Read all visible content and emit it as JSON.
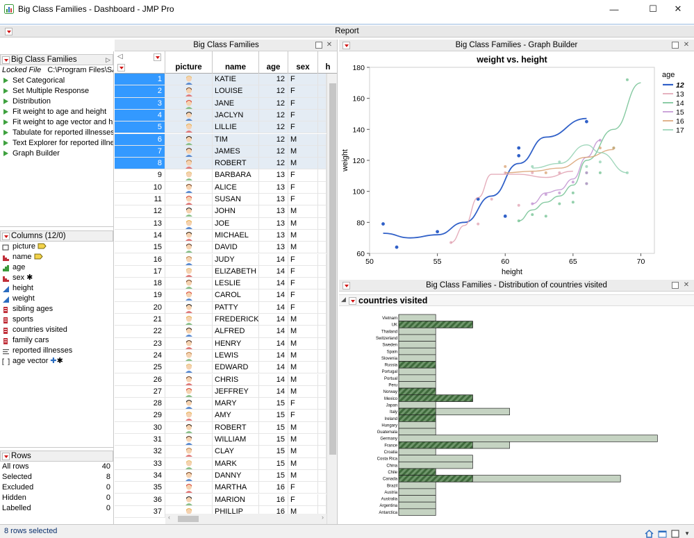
{
  "window": {
    "title": "Big Class Families - Dashboard - JMP Pro",
    "minimize_glyph": "—",
    "maximize_glyph": "☐",
    "close_glyph": "✕"
  },
  "report": {
    "title": "Report"
  },
  "table_panel": {
    "title": "Big Class Families"
  },
  "left": {
    "table_box": {
      "title": "Big Class Families",
      "locked_label": "Locked File",
      "locked_path": "C:\\Program Files\\SAS",
      "scripts": [
        "Set Categorical",
        "Set Multiple Response",
        "Distribution",
        "Fit weight to age and height",
        "Fit weight to age vector and h",
        "Tabulate for reported illnesses",
        "Text Explorer for reported illne",
        "Graph Builder"
      ]
    },
    "columns_box": {
      "title": "Columns (12/0)",
      "columns": [
        {
          "name": "picture",
          "icon": "expression-icon"
        },
        {
          "name": "name",
          "icon": "nominal-icon"
        },
        {
          "name": "age",
          "icon": "ordinal-icon"
        },
        {
          "name": "sex",
          "icon": "nominal-icon"
        },
        {
          "name": "height",
          "icon": "continuous-icon"
        },
        {
          "name": "weight",
          "icon": "continuous-icon"
        },
        {
          "name": "sibling ages",
          "icon": "multiple-response-icon"
        },
        {
          "name": "sports",
          "icon": "multiple-response-icon"
        },
        {
          "name": "countries visited",
          "icon": "multiple-response-icon"
        },
        {
          "name": "family cars",
          "icon": "multiple-response-icon"
        },
        {
          "name": "reported illnesses",
          "icon": "unstructured-text-icon"
        },
        {
          "name": "age vector",
          "icon": "vector-icon"
        }
      ]
    },
    "rows_box": {
      "title": "Rows",
      "stats": [
        {
          "label": "All rows",
          "value": "40"
        },
        {
          "label": "Selected",
          "value": "8"
        },
        {
          "label": "Excluded",
          "value": "0"
        },
        {
          "label": "Hidden",
          "value": "0"
        },
        {
          "label": "Labelled",
          "value": "0"
        }
      ]
    }
  },
  "grid": {
    "headers": [
      "picture",
      "name",
      "age",
      "sex",
      "h"
    ],
    "rows": [
      {
        "n": "1",
        "name": "KATIE",
        "age": "12",
        "sex": "F",
        "sel": true
      },
      {
        "n": "2",
        "name": "LOUISE",
        "age": "12",
        "sex": "F",
        "sel": true
      },
      {
        "n": "3",
        "name": "JANE",
        "age": "12",
        "sex": "F",
        "sel": true
      },
      {
        "n": "4",
        "name": "JACLYN",
        "age": "12",
        "sex": "F",
        "sel": true
      },
      {
        "n": "5",
        "name": "LILLIE",
        "age": "12",
        "sex": "F",
        "sel": true
      },
      {
        "n": "6",
        "name": "TIM",
        "age": "12",
        "sex": "M",
        "sel": true
      },
      {
        "n": "7",
        "name": "JAMES",
        "age": "12",
        "sex": "M",
        "sel": true
      },
      {
        "n": "8",
        "name": "ROBERT",
        "age": "12",
        "sex": "M",
        "sel": true
      },
      {
        "n": "9",
        "name": "BARBARA",
        "age": "13",
        "sex": "F",
        "sel": false
      },
      {
        "n": "10",
        "name": "ALICE",
        "age": "13",
        "sex": "F",
        "sel": false
      },
      {
        "n": "11",
        "name": "SUSAN",
        "age": "13",
        "sex": "F",
        "sel": false
      },
      {
        "n": "12",
        "name": "JOHN",
        "age": "13",
        "sex": "M",
        "sel": false
      },
      {
        "n": "13",
        "name": "JOE",
        "age": "13",
        "sex": "M",
        "sel": false
      },
      {
        "n": "14",
        "name": "MICHAEL",
        "age": "13",
        "sex": "M",
        "sel": false
      },
      {
        "n": "15",
        "name": "DAVID",
        "age": "13",
        "sex": "M",
        "sel": false
      },
      {
        "n": "16",
        "name": "JUDY",
        "age": "14",
        "sex": "F",
        "sel": false
      },
      {
        "n": "17",
        "name": "ELIZABETH",
        "age": "14",
        "sex": "F",
        "sel": false
      },
      {
        "n": "18",
        "name": "LESLIE",
        "age": "14",
        "sex": "F",
        "sel": false
      },
      {
        "n": "19",
        "name": "CAROL",
        "age": "14",
        "sex": "F",
        "sel": false
      },
      {
        "n": "20",
        "name": "PATTY",
        "age": "14",
        "sex": "F",
        "sel": false
      },
      {
        "n": "21",
        "name": "FREDERICK",
        "age": "14",
        "sex": "M",
        "sel": false
      },
      {
        "n": "22",
        "name": "ALFRED",
        "age": "14",
        "sex": "M",
        "sel": false
      },
      {
        "n": "23",
        "name": "HENRY",
        "age": "14",
        "sex": "M",
        "sel": false
      },
      {
        "n": "24",
        "name": "LEWIS",
        "age": "14",
        "sex": "M",
        "sel": false
      },
      {
        "n": "25",
        "name": "EDWARD",
        "age": "14",
        "sex": "M",
        "sel": false
      },
      {
        "n": "26",
        "name": "CHRIS",
        "age": "14",
        "sex": "M",
        "sel": false
      },
      {
        "n": "27",
        "name": "JEFFREY",
        "age": "14",
        "sex": "M",
        "sel": false
      },
      {
        "n": "28",
        "name": "MARY",
        "age": "15",
        "sex": "F",
        "sel": false
      },
      {
        "n": "29",
        "name": "AMY",
        "age": "15",
        "sex": "F",
        "sel": false
      },
      {
        "n": "30",
        "name": "ROBERT",
        "age": "15",
        "sex": "M",
        "sel": false
      },
      {
        "n": "31",
        "name": "WILLIAM",
        "age": "15",
        "sex": "M",
        "sel": false
      },
      {
        "n": "32",
        "name": "CLAY",
        "age": "15",
        "sex": "M",
        "sel": false
      },
      {
        "n": "33",
        "name": "MARK",
        "age": "15",
        "sex": "M",
        "sel": false
      },
      {
        "n": "34",
        "name": "DANNY",
        "age": "15",
        "sex": "M",
        "sel": false
      },
      {
        "n": "35",
        "name": "MARTHA",
        "age": "16",
        "sex": "F",
        "sel": false
      },
      {
        "n": "36",
        "name": "MARION",
        "age": "16",
        "sex": "F",
        "sel": false
      },
      {
        "n": "37",
        "name": "PHILLIP",
        "age": "16",
        "sex": "M",
        "sel": false
      }
    ]
  },
  "graph_panel": {
    "title": "Big Class Families - Graph Builder"
  },
  "dist_panel": {
    "title": "Big Class Families - Distribution of countries visited",
    "outline_title": "countries visited"
  },
  "status": {
    "text": "8 rows selected"
  },
  "colors": {
    "selection": "#3399ff",
    "age12": "#3060c8",
    "age13": "#e0a0b0",
    "age14": "#70c090",
    "age15": "#c090d0",
    "age16": "#d8a070",
    "age17": "#90d0b0",
    "bar_fill": "#c5d3c2",
    "bar_hatch": "#4f7a4c"
  },
  "chart_data": [
    {
      "type": "scatter",
      "title": "weight vs. height",
      "xlabel": "height",
      "ylabel": "weight",
      "xlim": [
        50,
        71
      ],
      "ylim": [
        60,
        180
      ],
      "xticks": [
        50,
        55,
        60,
        65,
        70
      ],
      "yticks": [
        60,
        80,
        100,
        120,
        140,
        160,
        180
      ],
      "legend_title": "age",
      "legend_position": "right",
      "series": [
        {
          "name": "12",
          "color": "#3060c8",
          "points": [
            [
              51,
              79
            ],
            [
              52,
              64
            ],
            [
              55,
              74
            ],
            [
              58,
              95
            ],
            [
              60,
              84
            ],
            [
              61,
              123
            ],
            [
              61,
              128
            ],
            [
              66,
              145
            ]
          ],
          "curve": [
            [
              51,
              73
            ],
            [
              53,
              70
            ],
            [
              55,
              72
            ],
            [
              57,
              80
            ],
            [
              59,
              97
            ],
            [
              61,
              118
            ],
            [
              63,
              135
            ],
            [
              66,
              147
            ]
          ]
        },
        {
          "name": "13",
          "color": "#e0a0b0",
          "points": [
            [
              56,
              67
            ],
            [
              58,
              79
            ],
            [
              59,
              95
            ],
            [
              60,
              112
            ],
            [
              61,
              91
            ],
            [
              62,
              112
            ],
            [
              64,
              112
            ]
          ],
          "curve": [
            [
              56,
              67
            ],
            [
              57,
              78
            ],
            [
              58,
              96
            ],
            [
              59,
              111
            ],
            [
              61,
              111
            ],
            [
              63,
              109
            ],
            [
              65,
              113
            ]
          ]
        },
        {
          "name": "14",
          "color": "#70c090",
          "points": [
            [
              61,
              81
            ],
            [
              62,
              85
            ],
            [
              63,
              84
            ],
            [
              64,
              92
            ],
            [
              65,
              93
            ],
            [
              65,
              99
            ],
            [
              66,
              105
            ],
            [
              66,
              112
            ],
            [
              67,
              112
            ],
            [
              68,
              128
            ],
            [
              69,
              172
            ]
          ],
          "curve": [
            [
              61,
              81
            ],
            [
              62,
              88
            ],
            [
              63,
              93
            ],
            [
              64,
              97
            ],
            [
              65,
              104
            ],
            [
              66,
              120
            ],
            [
              68,
              140
            ],
            [
              70,
              170
            ]
          ]
        },
        {
          "name": "15",
          "color": "#c090d0",
          "points": [
            [
              62,
              92
            ],
            [
              63,
              98
            ],
            [
              64,
              99
            ],
            [
              65,
              106
            ],
            [
              66,
              105
            ],
            [
              66,
              112
            ],
            [
              67,
              133
            ]
          ],
          "curve": [
            [
              62,
              92
            ],
            [
              63,
              99
            ],
            [
              64,
              101
            ],
            [
              65,
              108
            ],
            [
              66,
              122
            ],
            [
              67,
              133
            ]
          ]
        },
        {
          "name": "16",
          "color": "#d8a070",
          "points": [
            [
              60,
              116
            ],
            [
              63,
              112
            ],
            [
              67,
              128
            ],
            [
              68,
              128
            ]
          ],
          "curve": [
            [
              60,
              112
            ],
            [
              62,
              113
            ],
            [
              64,
              115
            ],
            [
              66,
              122
            ],
            [
              68,
              127
            ]
          ]
        },
        {
          "name": "17",
          "color": "#90d0b0",
          "points": [
            [
              62,
              116
            ],
            [
              64,
              119
            ],
            [
              66,
              116
            ],
            [
              67,
              119
            ],
            [
              69,
              112
            ]
          ],
          "curve": [
            [
              62,
              115
            ],
            [
              64,
              118
            ],
            [
              66,
              130
            ],
            [
              67,
              125
            ],
            [
              69,
              112
            ]
          ]
        }
      ]
    },
    {
      "type": "bar",
      "orientation": "horizontal",
      "title": "countries visited",
      "categories": [
        "Vietnam",
        "UK",
        "Thailand",
        "Switzerland",
        "Sweden",
        "Spain",
        "Slovenia",
        "Russia",
        "Portugal",
        "Portual",
        "Peru",
        "Norway",
        "Mexico",
        "Japan",
        "Italy",
        "Ireland",
        "Hungary",
        "Guatemala",
        "Germany",
        "France",
        "Croatia",
        "Costa Rica",
        "China",
        "Chile",
        "Canada",
        "Brazil",
        "Austria",
        "Australia",
        "Argentina",
        "Antarctica"
      ],
      "values": [
        1,
        2,
        1,
        1,
        1,
        1,
        1,
        1,
        1,
        1,
        1,
        1,
        2,
        1,
        3,
        1,
        1,
        1,
        7,
        3,
        1,
        2,
        2,
        1,
        6,
        1,
        1,
        1,
        1,
        1
      ],
      "selected_values": [
        0,
        2,
        0,
        0,
        0,
        0,
        0,
        1,
        0,
        0,
        0,
        1,
        2,
        0,
        1,
        1,
        0,
        0,
        0,
        2,
        0,
        0,
        0,
        1,
        2,
        0,
        0,
        0,
        0,
        0
      ]
    }
  ]
}
